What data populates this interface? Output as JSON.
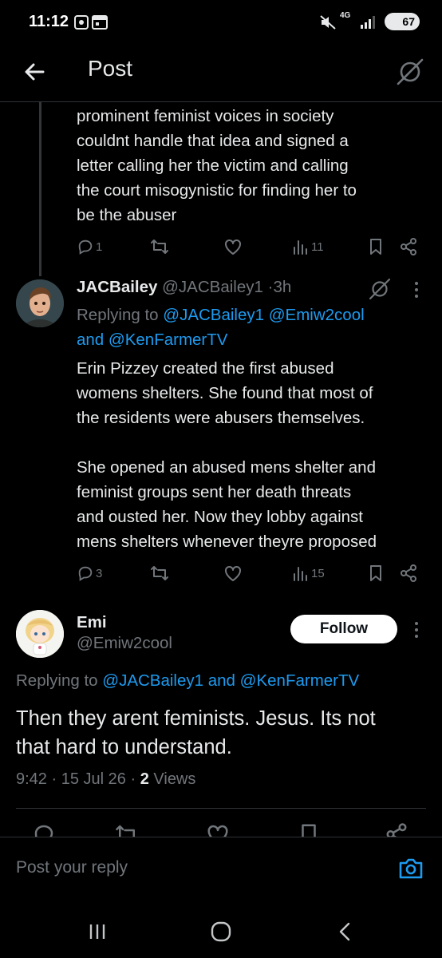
{
  "status_bar": {
    "time": "11:12",
    "network": "4G",
    "battery": "67"
  },
  "header": {
    "title": "Post"
  },
  "tweet_partial": {
    "lines": [
      "prominent feminist voices in society",
      "couldnt handle that idea and signed a",
      "letter calling her the victim and calling",
      "the court misogynistic for finding her to",
      "be the abuser"
    ],
    "replies": "1",
    "views": "11"
  },
  "reply_tweet": {
    "display_name": "JACBailey",
    "handle": "@JACBailey1",
    "separator": "·",
    "time": "3h",
    "replying_prefix": "Replying to",
    "replying_mentions_1": "@JACBailey1 @Emiw2cool",
    "replying_and": "and",
    "replying_mentions_2": "@KenFarmerTV",
    "lines": [
      "Erin Pizzey created the first abused",
      "womens shelters. She found that most of",
      "the residents were abusers themselves.",
      "",
      "She opened an abused mens shelter and",
      "feminist groups sent her death threats",
      "and ousted her. Now they lobby against",
      "mens shelters whenever theyre proposed"
    ],
    "replies": "3",
    "views": "15"
  },
  "main_tweet": {
    "display_name": "Emi",
    "handle": "@Emiw2cool",
    "follow_label": "Follow",
    "replying_prefix": "Replying to",
    "replying_mention_1": "@JACBailey1",
    "replying_and": "and",
    "replying_mention_2": "@KenFarmerTV",
    "text_line_1": "Then they arent feminists. Jesus. Its not",
    "text_line_2": "that hard to understand.",
    "time": "9:42",
    "date": "15 Jul 26",
    "views_count": "2",
    "views_label": "Views",
    "dot": "·"
  },
  "reply_bar": {
    "placeholder": "Post your reply"
  },
  "colors": {
    "background": "#000000",
    "text": "#e7e9ea",
    "muted": "#71767b",
    "link": "#1d9bf0",
    "divider": "#2f3336"
  },
  "icons": [
    "back-arrow-icon",
    "grok-icon",
    "reply-icon",
    "repost-icon",
    "like-icon",
    "views-icon",
    "bookmark-icon",
    "share-icon",
    "more-icon",
    "camera-icon"
  ]
}
